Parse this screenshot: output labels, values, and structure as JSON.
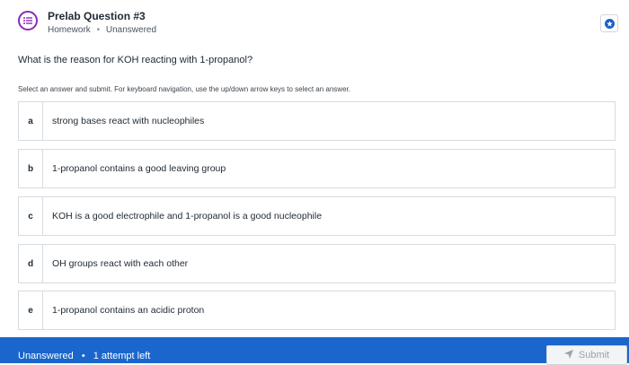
{
  "header": {
    "title": "Prelab Question #3",
    "category": "Homework",
    "separator": "•",
    "status": "Unanswered",
    "icon": "question-list-icon",
    "accent_color": "#8b2bb8",
    "action_icon": "star-icon"
  },
  "question": {
    "text": "What is the reason for KOH reacting with 1-propanol?",
    "instructions": "Select an answer and submit. For keyboard navigation, use the up/down arrow keys to select an answer."
  },
  "choices": [
    {
      "letter": "a",
      "text": "strong bases react with nucleophiles"
    },
    {
      "letter": "b",
      "text": "1-propanol contains a good leaving group"
    },
    {
      "letter": "c",
      "text": "KOH is a good electrophile and 1-propanol is a good nucleophile"
    },
    {
      "letter": "d",
      "text": "OH groups react with each other"
    },
    {
      "letter": "e",
      "text": "1-propanol contains an acidic proton"
    }
  ],
  "footer": {
    "status": "Unanswered",
    "bullet": "•",
    "attempts": "1 attempt left",
    "submit_label": "Submit",
    "submit_icon": "send-icon",
    "bar_color": "#1a66cc"
  }
}
